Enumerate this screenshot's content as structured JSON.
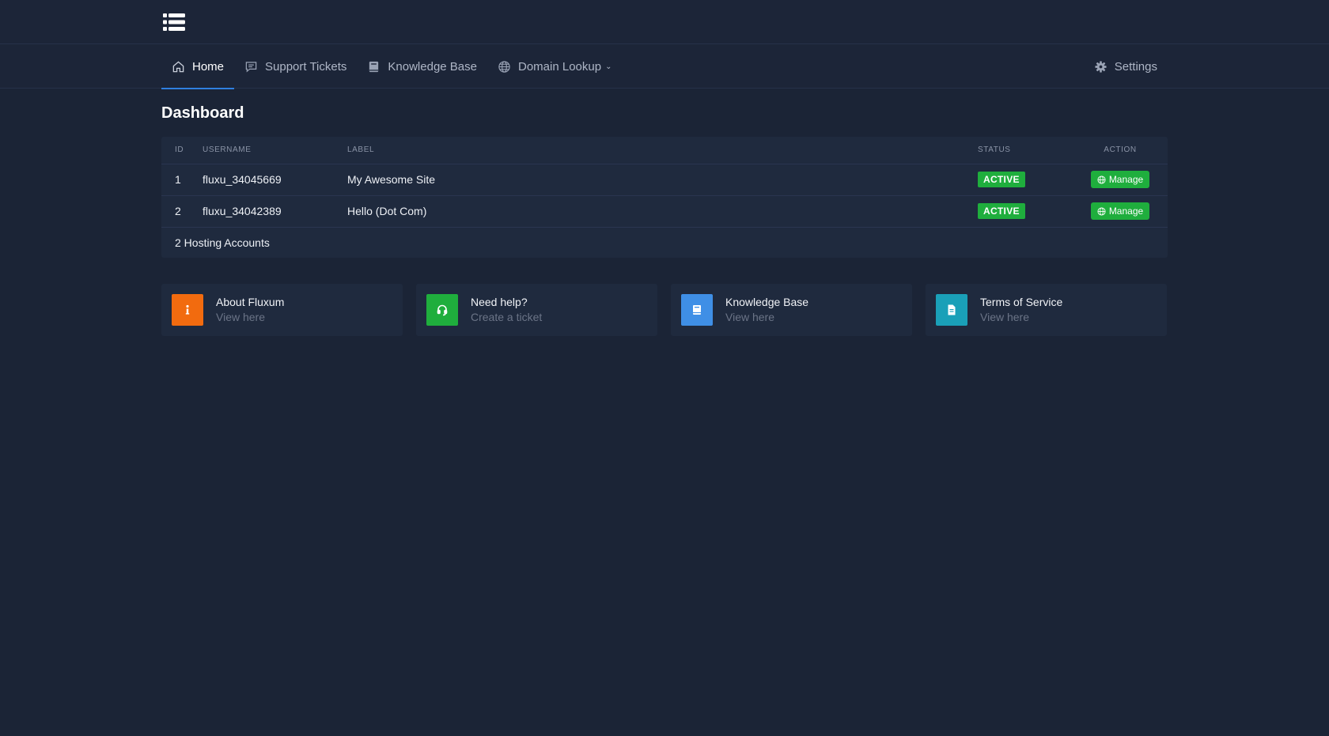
{
  "nav": {
    "items": [
      {
        "label": "Home",
        "icon": "home-icon",
        "active": true
      },
      {
        "label": "Support Tickets",
        "icon": "chat-icon"
      },
      {
        "label": "Knowledge Base",
        "icon": "book-icon"
      },
      {
        "label": "Domain Lookup",
        "icon": "globe-icon",
        "dropdown": true
      }
    ],
    "settings_label": "Settings"
  },
  "page": {
    "title": "Dashboard"
  },
  "table": {
    "headers": {
      "id": "ID",
      "username": "USERNAME",
      "label": "LABEL",
      "status": "STATUS",
      "action": "ACTION"
    },
    "rows": [
      {
        "id": "1",
        "username": "fluxu_34045669",
        "label": "My Awesome Site",
        "status": "ACTIVE",
        "action": "Manage"
      },
      {
        "id": "2",
        "username": "fluxu_34042389",
        "label": "Hello (Dot Com)",
        "status": "ACTIVE",
        "action": "Manage"
      }
    ],
    "footer": "2 Hosting Accounts"
  },
  "cards": [
    {
      "title": "About Fluxum",
      "sub": "View here",
      "icon": "info-icon",
      "color": "#f26b0f"
    },
    {
      "title": "Need help?",
      "sub": "Create a ticket",
      "icon": "headset-icon",
      "color": "#1fae3d"
    },
    {
      "title": "Knowledge Base",
      "sub": "View here",
      "icon": "book-icon",
      "color": "#3f8fe6"
    },
    {
      "title": "Terms of Service",
      "sub": "View here",
      "icon": "document-icon",
      "color": "#1aa0b8"
    }
  ],
  "colors": {
    "background": "#1b2436",
    "accent": "#2f7fe0",
    "success": "#1fae3d"
  }
}
